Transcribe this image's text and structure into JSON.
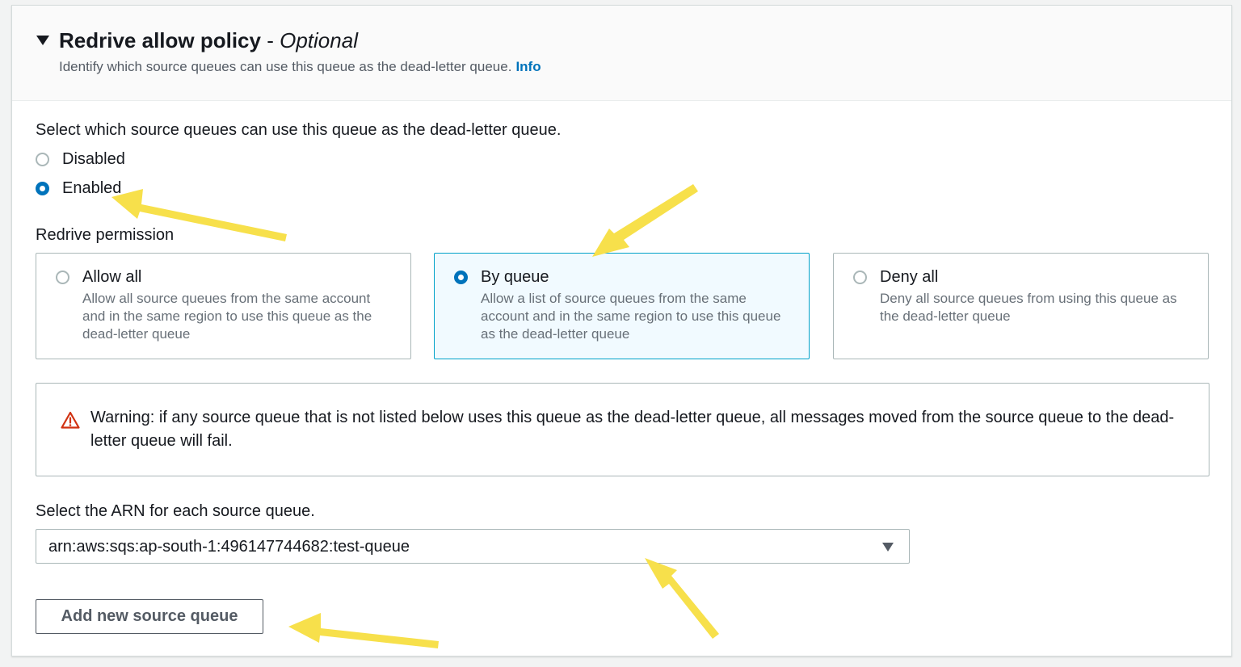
{
  "header": {
    "title": "Redrive allow policy",
    "separator": "-",
    "optional": "Optional",
    "description": "Identify which source queues can use this queue as the dead-letter queue.",
    "info_link": "Info"
  },
  "policy": {
    "prompt": "Select which source queues can use this queue as the dead-letter queue.",
    "options": [
      {
        "label": "Disabled",
        "checked": false
      },
      {
        "label": "Enabled",
        "checked": true
      }
    ]
  },
  "permission": {
    "label": "Redrive permission",
    "tiles": [
      {
        "title": "Allow all",
        "description": "Allow all source queues from the same account and in the same region to use this queue as the dead-letter queue",
        "selected": false
      },
      {
        "title": "By queue",
        "description": "Allow a list of source queues from the same account and in the same region to use this queue as the dead-letter queue",
        "selected": true
      },
      {
        "title": "Deny all",
        "description": "Deny all source queues from using this queue as the dead-letter queue",
        "selected": false
      }
    ]
  },
  "warning": {
    "icon": "warning-triangle-icon",
    "text": "Warning: if any source queue that is not listed below uses this queue as the dead-letter queue, all messages moved from the source queue to the dead-letter queue will fail."
  },
  "arn": {
    "label": "Select the ARN for each source queue.",
    "selected_value": "arn:aws:sqs:ap-south-1:496147744682:test-queue"
  },
  "add_button": {
    "label": "Add new source queue"
  },
  "colors": {
    "accent": "#0073bb",
    "annotation_arrow": "#f7e04b",
    "warning": "#d13212",
    "selected_tile_bg": "#f1faff"
  }
}
